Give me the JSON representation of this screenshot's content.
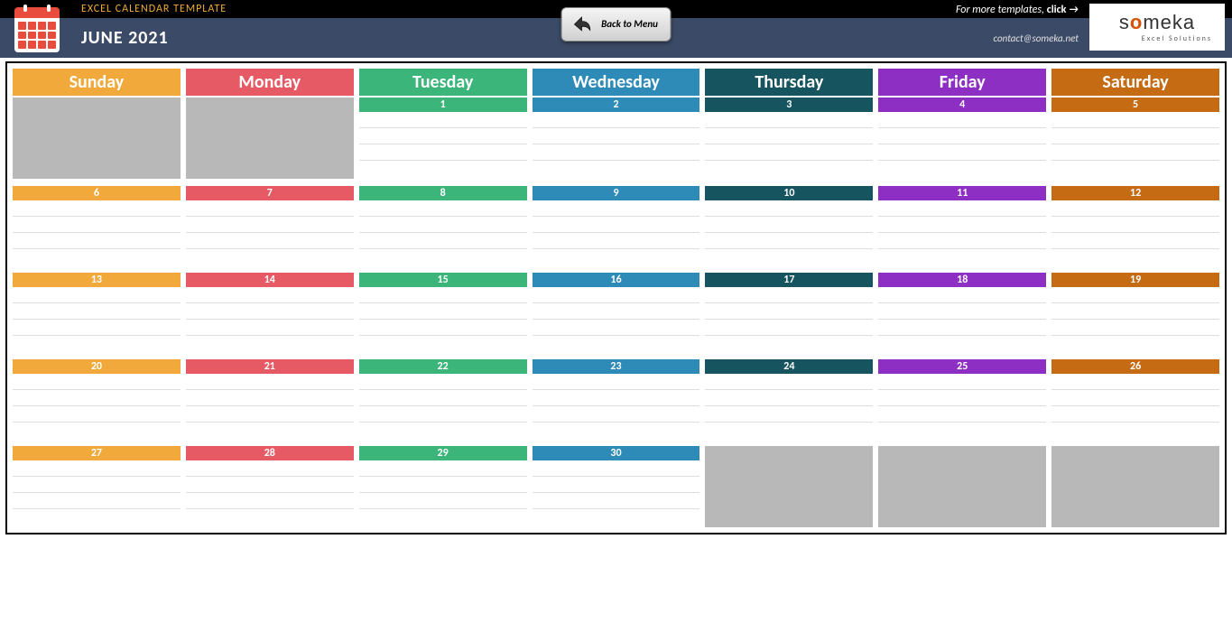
{
  "header": {
    "template_title": "EXCEL CALENDAR TEMPLATE",
    "month_title": "JUNE 2021",
    "back_button": "Back to Menu",
    "more_templates_text": "For more templates,",
    "more_templates_action": "click",
    "contact": "contact@someka.net",
    "logo_main": "someka",
    "logo_sub": "Excel Solutions"
  },
  "days": [
    {
      "name": "Sunday",
      "color": "#f2a93b"
    },
    {
      "name": "Monday",
      "color": "#e55a65"
    },
    {
      "name": "Tuesday",
      "color": "#3bb57a"
    },
    {
      "name": "Wednesday",
      "color": "#2e8bb8"
    },
    {
      "name": "Thursday",
      "color": "#16555f"
    },
    {
      "name": "Friday",
      "color": "#8e2fc4"
    },
    {
      "name": "Saturday",
      "color": "#c46b14"
    }
  ],
  "weeks": [
    [
      null,
      null,
      "1",
      "2",
      "3",
      "4",
      "5"
    ],
    [
      "6",
      "7",
      "8",
      "9",
      "10",
      "11",
      "12"
    ],
    [
      "13",
      "14",
      "15",
      "16",
      "17",
      "18",
      "19"
    ],
    [
      "20",
      "21",
      "22",
      "23",
      "24",
      "25",
      "26"
    ],
    [
      "27",
      "28",
      "29",
      "30",
      null,
      null,
      null
    ]
  ]
}
